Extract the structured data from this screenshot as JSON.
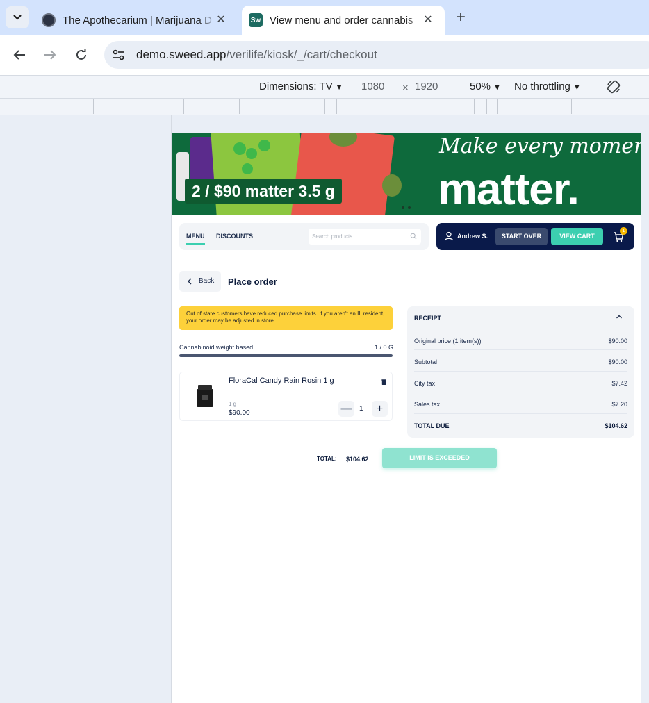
{
  "browser": {
    "tabs": [
      {
        "title": "The Apothecarium | Marijuana D",
        "close_label": "✕"
      },
      {
        "title": "View menu and order cannabis",
        "close_label": "✕",
        "favicon_text": "Sw"
      }
    ],
    "new_tab_label": "+",
    "url_host": "demo.sweed.app",
    "url_path": "/verilife/kiosk/_/cart/checkout"
  },
  "devtools": {
    "dimensions_label": "Dimensions: TV",
    "width": "1080",
    "times": "×",
    "height": "1920",
    "zoom": "50%",
    "throttling": "No throttling"
  },
  "banner": {
    "promo": "2 / $90 matter 3.5 g",
    "tagline": "Make every moment",
    "headline": "matter."
  },
  "kiosk_nav": {
    "menu_label": "MENU",
    "discounts_label": "DISCOUNTS",
    "search_placeholder": "Search products"
  },
  "user": {
    "name": "Andrew S.",
    "start_over_label": "START OVER",
    "view_cart_label": "VIEW CART",
    "cart_count": "1"
  },
  "checkout": {
    "back_label": "Back",
    "title": "Place order",
    "alert_text": "Out of state customers have reduced purchase limits. If you aren't an IL resident, your order may be adjusted in store.",
    "limit_label": "Cannabinoid weight based",
    "limit_value": "1 / 0 G",
    "limit_fraction": 1.0,
    "item": {
      "name": "FloraCal Candy Rain Rosin 1 g",
      "weight": "1 g",
      "price": "$90.00",
      "quantity": "1",
      "minus_label": "—",
      "plus_label": "+"
    },
    "receipt": {
      "heading": "RECEIPT",
      "rows": [
        {
          "label": "Original price (1 item(s))",
          "value": "$90.00"
        },
        {
          "label": "Subtotal",
          "value": "$90.00"
        },
        {
          "label": "City tax",
          "value": "$7.42"
        },
        {
          "label": "Sales tax",
          "value": "$7.20"
        },
        {
          "label": "TOTAL DUE",
          "value": "$104.62"
        }
      ]
    },
    "total_label": "TOTAL:",
    "total_value": "$104.62",
    "submit_label": "LIMIT IS EXCEEDED"
  },
  "colors": {
    "accent": "#3ccfb0",
    "navy": "#0a1a4a",
    "alert": "#fdd13a",
    "banner_green": "#0e6a3c"
  }
}
